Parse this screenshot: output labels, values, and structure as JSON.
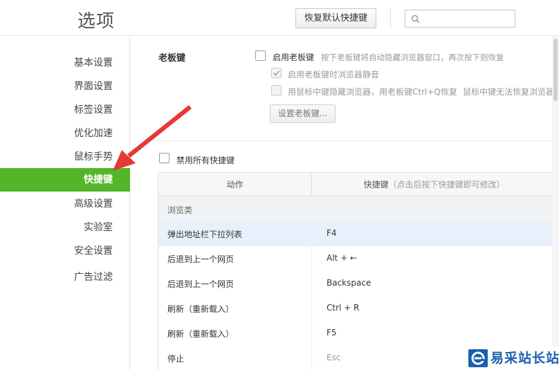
{
  "header": {
    "title": "选项",
    "restore_button": "恢复默认快捷键",
    "search_placeholder": ""
  },
  "sidebar": {
    "items": [
      {
        "label": "基本设置",
        "active": false
      },
      {
        "label": "界面设置",
        "active": false
      },
      {
        "label": "标签设置",
        "active": false
      },
      {
        "label": "优化加速",
        "active": false
      },
      {
        "label": "鼠标手势",
        "active": false
      },
      {
        "label": "快捷键",
        "active": true
      },
      {
        "label": "高级设置",
        "active": false
      },
      {
        "label": "实验室",
        "active": false
      },
      {
        "label": "安全设置",
        "active": false
      },
      {
        "label": "广告过滤",
        "active": false
      }
    ]
  },
  "boss_key": {
    "section_title": "老板键",
    "enable_label": "启用老板键",
    "enable_hint": "按下老板键将自动隐藏浏览器窗口，再次按下则恢复",
    "mute_label": "启用老板键时浏览器静音",
    "mute_checked": true,
    "middle_click_label": "用鼠标中键隐藏浏览器，用老板键Ctrl+Q恢复",
    "middle_click_hint": "鼠标中键无法恢复浏览器",
    "set_button": "设置老板键..."
  },
  "disable_all_label": "禁用所有快捷键",
  "table": {
    "col_action": "动作",
    "col_shortcut": "快捷键",
    "col_shortcut_hint": "（点击后按下快捷键即可修改）",
    "group_label": "浏览类",
    "rows": [
      {
        "action": "弹出地址栏下拉列表",
        "key": "F4"
      },
      {
        "action": "后退到上一个网页",
        "key": "Alt + ←"
      },
      {
        "action": "后退到上一个网页",
        "key": "Backspace"
      },
      {
        "action": "刷新（重新载入）",
        "key": "Ctrl + R"
      },
      {
        "action": "刷新（重新载入）",
        "key": "F5"
      },
      {
        "action": "停止",
        "key": "Esc"
      }
    ]
  },
  "watermark": {
    "text": "易采站长站"
  },
  "colors": {
    "accent_green": "#54b52b",
    "annotation_arrow": "#e53935",
    "selected_row": "#e8f1fb"
  }
}
